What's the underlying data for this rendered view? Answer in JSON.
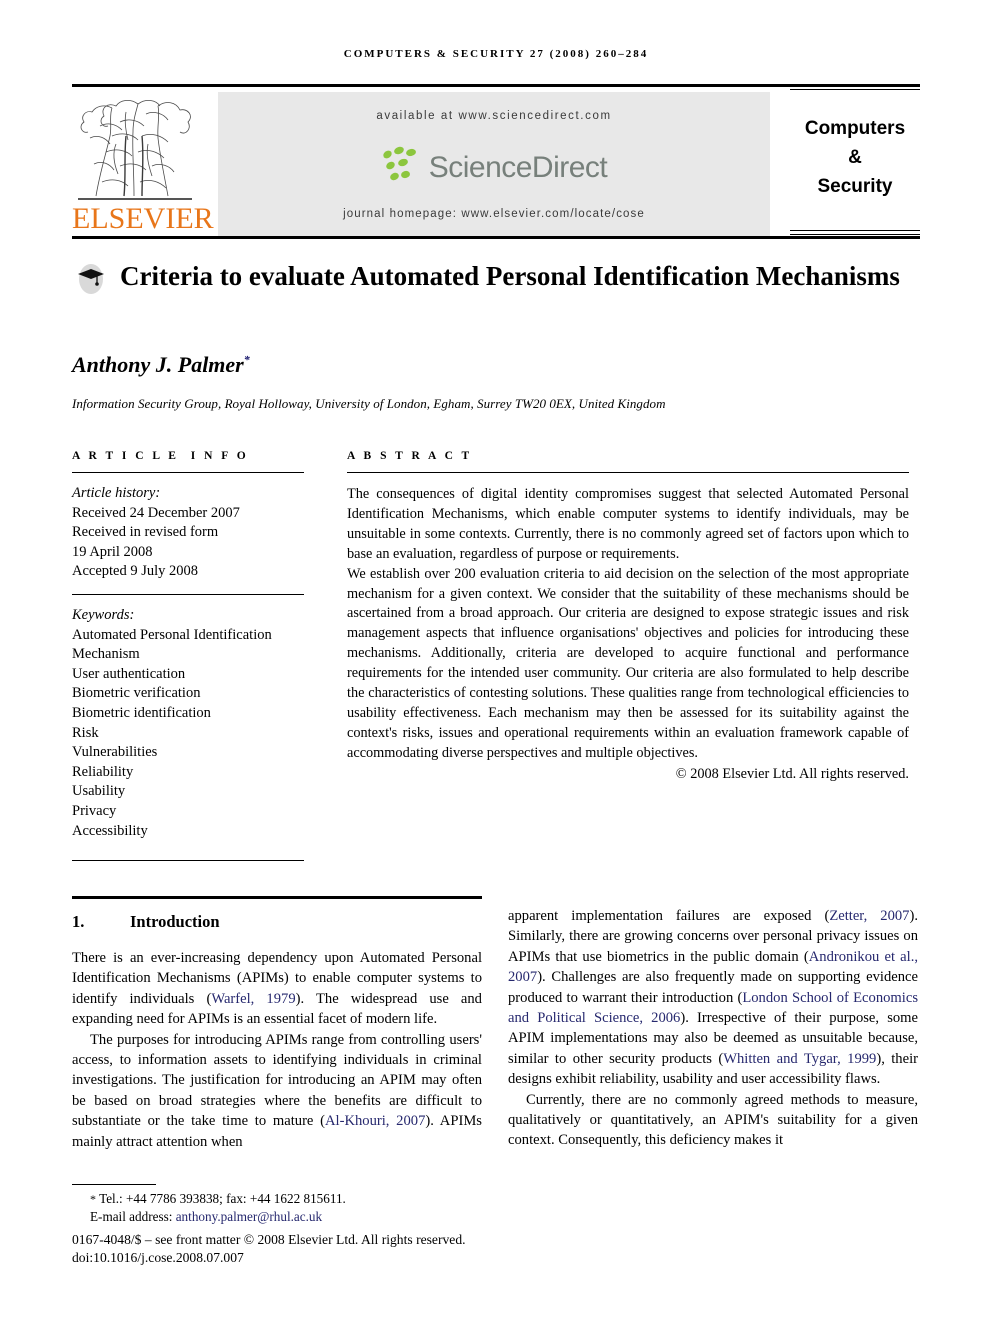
{
  "running_head": "COMPUTERS & SECURITY 27 (2008) 260–284",
  "masthead": {
    "publisher_word": "ELSEVIER",
    "available_at": "available at www.sciencedirect.com",
    "sciencedirect_word": "ScienceDirect",
    "journal_homepage": "journal homepage: www.elsevier.com/locate/cose",
    "journal_name_line1": "Computers",
    "journal_name_line2": "&",
    "journal_name_line3": "Security",
    "accent_orange": "#E8761A",
    "leaf_green": "#8cc63e",
    "banner_gray": "#e8e8e8",
    "wordmark_gray": "#77807b"
  },
  "article": {
    "title": "Criteria to evaluate Automated Personal Identification Mechanisms",
    "author": "Anthony J. Palmer",
    "author_marker": "*",
    "affiliation": "Information Security Group, Royal Holloway, University of London, Egham, Surrey TW20 0EX, United Kingdom"
  },
  "info": {
    "heading": "ARTICLE INFO",
    "history_label": "Article history:",
    "history": [
      "Received 24 December 2007",
      "Received in revised form",
      "19 April 2008",
      "Accepted 9 July 2008"
    ],
    "keywords_label": "Keywords:",
    "keywords": [
      "Automated Personal Identification",
      "Mechanism",
      "User authentication",
      "Biometric verification",
      "Biometric identification",
      "Risk",
      "Vulnerabilities",
      "Reliability",
      "Usability",
      "Privacy",
      "Accessibility"
    ]
  },
  "abstract": {
    "heading": "ABSTRACT",
    "paragraph1": "The consequences of digital identity compromises suggest that selected Automated Personal Identification Mechanisms, which enable computer systems to identify individuals, may be unsuitable in some contexts. Currently, there is no commonly agreed set of factors upon which to base an evaluation, regardless of purpose or requirements.",
    "paragraph2": "We establish over 200 evaluation criteria to aid decision on the selection of the most appropriate mechanism for a given context. We consider that the suitability of these mechanisms should be ascertained from a broad approach. Our criteria are designed to expose strategic issues and risk management aspects that influence organisations' objectives and policies for introducing these mechanisms. Additionally, criteria are developed to acquire functional and performance requirements for the intended user community. Our criteria are also formulated to help describe the characteristics of contesting solutions. These qualities range from technological efficiencies to usability effectiveness. Each mechanism may then be assessed for its suitability against the context's risks, issues and operational requirements within an evaluation framework capable of accommodating diverse perspectives and multiple objectives.",
    "copyright": "© 2008 Elsevier Ltd. All rights reserved."
  },
  "body": {
    "section_number": "1.",
    "section_title": "Introduction",
    "left_paragraph_1_a": "There is an ever-increasing dependency upon Automated Personal Identification Mechanisms (APIMs) to enable computer systems to identify individuals (",
    "left_paragraph_1_cite": "Warfel, 1979",
    "left_paragraph_1_b": "). The widespread use and expanding need for APIMs is an essential facet of modern life.",
    "left_paragraph_2_a": "The purposes for introducing APIMs range from controlling users' access, to information assets to identifying individuals in criminal investigations. The justification for introducing an APIM may often be based on broad strategies where the benefits are difficult to substantiate or the take time to mature (",
    "left_paragraph_2_cite": "Al-Khouri, 2007",
    "left_paragraph_2_b": "). APIMs mainly attract attention when",
    "right_paragraph_1_a": "apparent implementation failures are exposed (",
    "right_cite_1": "Zetter, 2007",
    "right_paragraph_1_b": "). Similarly, there are growing concerns over personal privacy issues on APIMs that use biometrics in the public domain (",
    "right_cite_2": "Andronikou et al., 2007",
    "right_paragraph_1_c": "). Challenges are also frequently made on supporting evidence produced to warrant their introduction (",
    "right_cite_3": "London School of Economics and Political Science, 2006",
    "right_paragraph_1_d": "). Irrespective of their purpose, some APIM implementations may also be deemed as unsuitable because, similar to other security products (",
    "right_cite_4": "Whitten and Tygar, 1999",
    "right_paragraph_1_e": "), their designs exhibit reliability, usability and user accessibility flaws.",
    "right_paragraph_2": "Currently, there are no commonly agreed methods to measure, qualitatively or quantitatively, an APIM's suitability for a given context. Consequently, this deficiency makes it",
    "citation_color": "#26286e"
  },
  "footnote": {
    "marker": "*",
    "tel_fax": "Tel.: +44 7786 393838; fax: +44 1622 815611.",
    "email_label": "E-mail address:",
    "email": "anthony.palmer@rhul.ac.uk",
    "front_matter": "0167-4048/$ – see front matter © 2008 Elsevier Ltd. All rights reserved.",
    "doi": "doi:10.1016/j.cose.2008.07.007"
  }
}
